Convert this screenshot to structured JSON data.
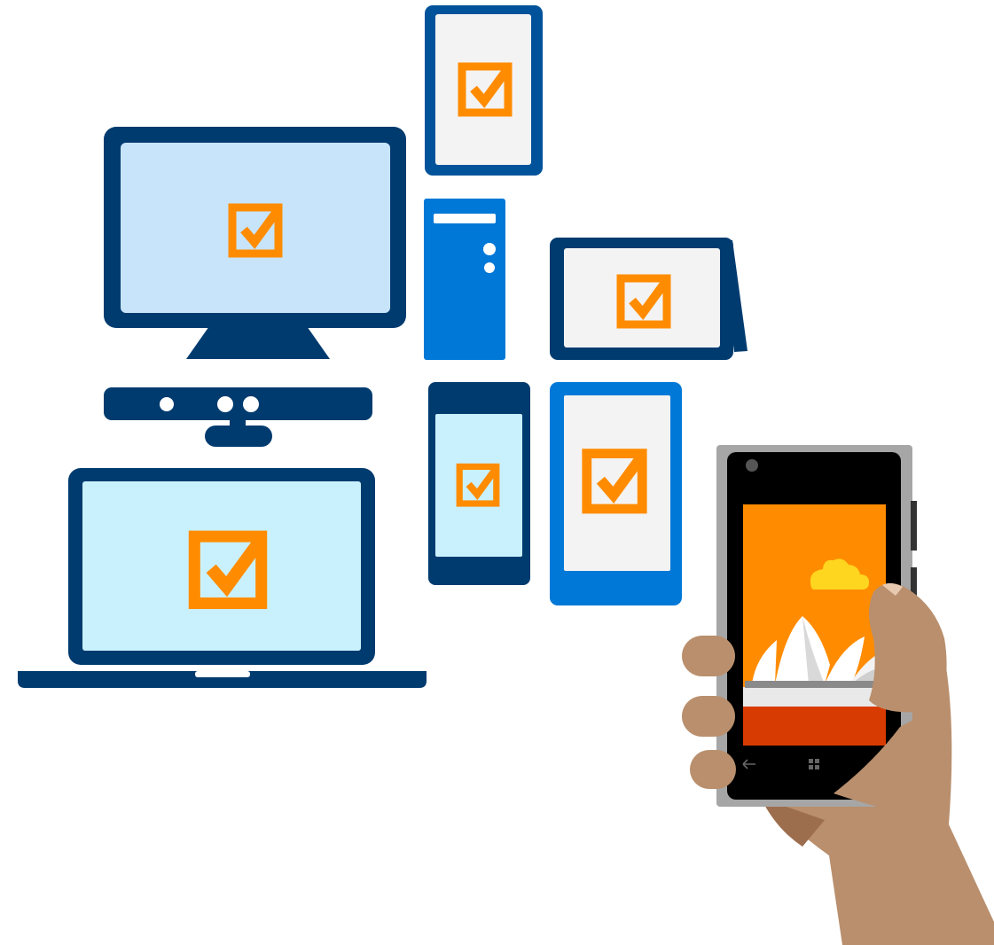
{
  "illustration": {
    "devices": [
      {
        "name": "desktop-monitor",
        "icon": "checkbox-checked-icon"
      },
      {
        "name": "tablet-portrait",
        "icon": "checkbox-checked-icon"
      },
      {
        "name": "pc-tower"
      },
      {
        "name": "surface-tablet",
        "icon": "checkbox-checked-icon"
      },
      {
        "name": "kinect-sensor"
      },
      {
        "name": "laptop",
        "icon": "checkbox-checked-icon"
      },
      {
        "name": "small-phone",
        "icon": "checkbox-checked-icon"
      },
      {
        "name": "large-phone",
        "icon": "checkbox-checked-icon"
      },
      {
        "name": "handheld-windows-phone",
        "screen_icons": [
          "cloud-icon",
          "opera-house-icon",
          "back-arrow-icon",
          "windows-logo-icon"
        ]
      }
    ],
    "colors": {
      "navy": "#003b6f",
      "blue": "#0078d7",
      "dark_blue": "#00539b",
      "light_blue_screen": "#c7e4fb",
      "cyan_screen": "#c9f1fd",
      "grey_screen": "#f3f3f3",
      "checkbox_orange": "#ff8c00",
      "phone_orange": "#ff8c00",
      "phone_red": "#d83b01",
      "cloud_yellow": "#ffd61f",
      "skin": "#b98f6d",
      "skin_shadow": "#9d6e4e",
      "phone_frame": "#a6a6a6"
    }
  }
}
